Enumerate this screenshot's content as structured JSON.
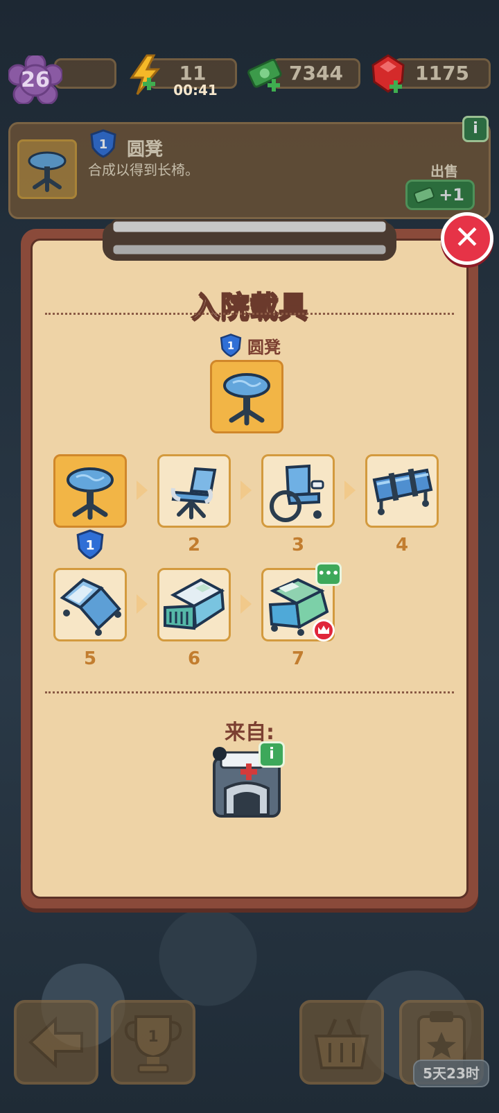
{
  "topbar": {
    "level": "26",
    "energy": "11",
    "energy_timer": "00:41",
    "cash": "7344",
    "gems": "1175"
  },
  "info": {
    "item_level": "1",
    "item_name": "圆凳",
    "description": "合成以得到长椅。",
    "sell_label": "出售",
    "sell_value": "+1",
    "info_icon": "i"
  },
  "modal": {
    "title": "入院载具",
    "selected_level": "1",
    "selected_name": "圆凳",
    "close_glyph": "✕",
    "from_label": "来自:",
    "source_info_icon": "i",
    "chain": [
      {
        "label": "1",
        "name": "stool",
        "active": true
      },
      {
        "label": "2",
        "name": "chair",
        "active": false
      },
      {
        "label": "3",
        "name": "wheelchair",
        "active": false
      },
      {
        "label": "4",
        "name": "stretcher",
        "active": false
      },
      {
        "label": "5",
        "name": "hospital-bed",
        "active": false
      },
      {
        "label": "6",
        "name": "ward-bed",
        "active": false
      },
      {
        "label": "7",
        "name": "deluxe-bed",
        "active": false
      }
    ],
    "chat_badge": "•••"
  },
  "bottom": {
    "trophy_number": "1",
    "timer": "5天23时"
  },
  "colors": {
    "panel": "#eed3a6",
    "frame": "#8a4a3a",
    "tile_active": "#f2b546",
    "tile_border": "#d39a3e",
    "close": "#e63347",
    "accent_blue": "#2f6fd6"
  }
}
